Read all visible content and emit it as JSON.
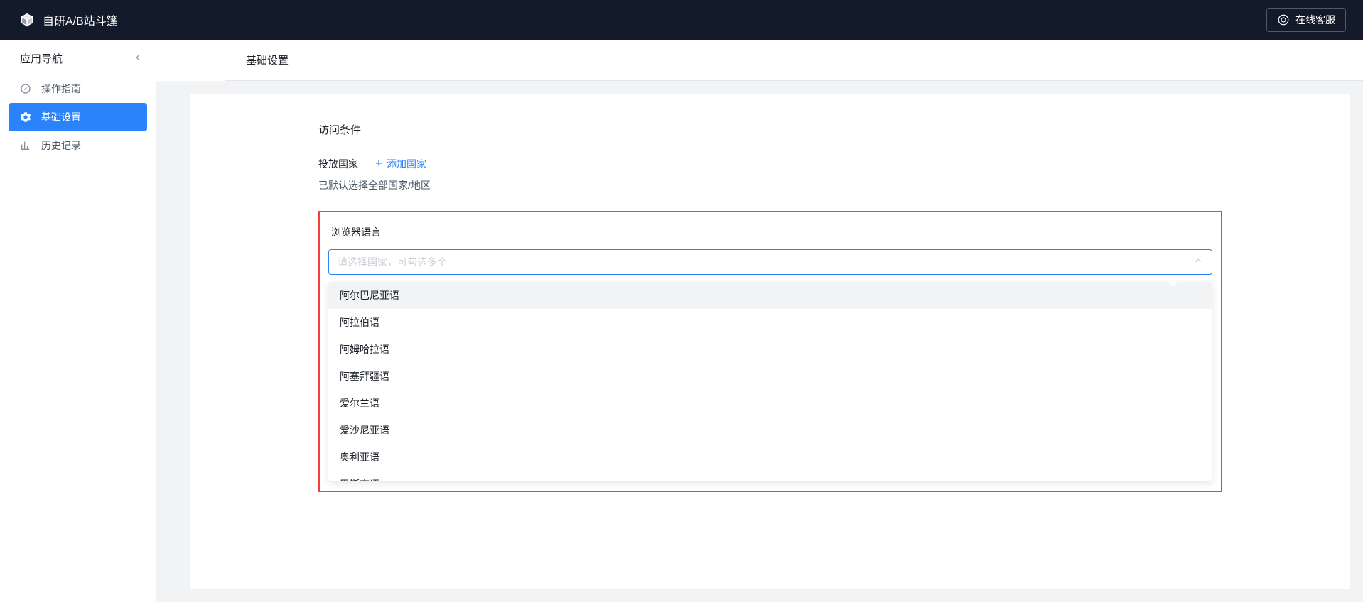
{
  "header": {
    "app_title": "自研A/B站斗篷",
    "support_label": "在线客服"
  },
  "sidebar": {
    "title": "应用导航",
    "items": [
      {
        "label": "操作指南",
        "active": false
      },
      {
        "label": "基础设置",
        "active": true
      },
      {
        "label": "历史记录",
        "active": false
      }
    ]
  },
  "page": {
    "title": "基础设置"
  },
  "form": {
    "access_condition_title": "访问条件",
    "country_label": "投放国家",
    "add_country_label": "添加国家",
    "country_hint": "已默认选择全部国家/地区",
    "language_label": "浏览器语言",
    "language_placeholder": "请选择国家，可勾选多个"
  },
  "dropdown": {
    "options": [
      "阿尔巴尼亚语",
      "阿拉伯语",
      "阿姆哈拉语",
      "阿塞拜疆语",
      "爱尔兰语",
      "爱沙尼亚语",
      "奥利亚语",
      "巴斯克语"
    ]
  },
  "colors": {
    "primary": "#2a83fb",
    "danger": "#f53f3f",
    "header_bg": "#131a2a"
  }
}
